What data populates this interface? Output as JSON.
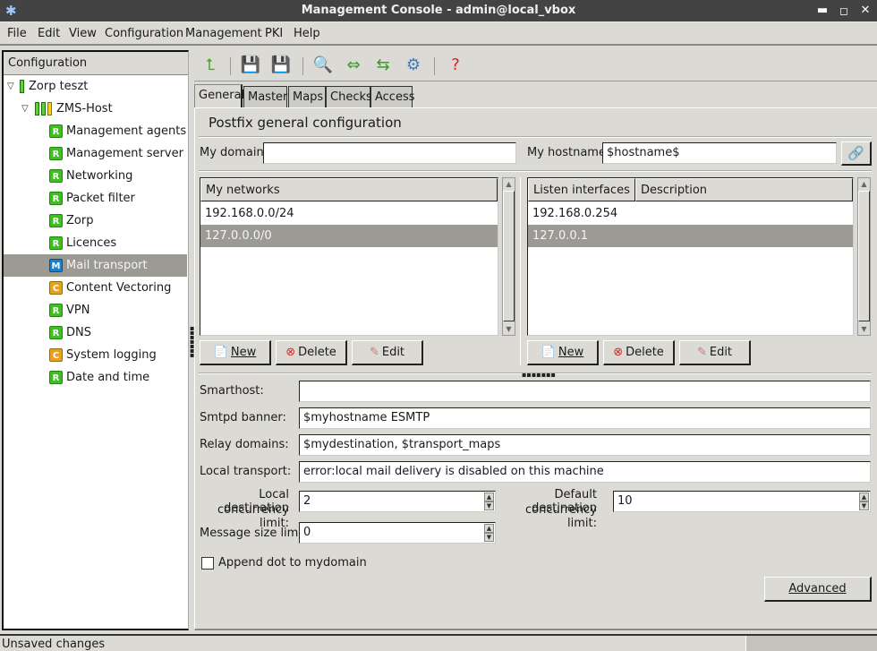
{
  "window": {
    "title": "Management Console - admin@local_vbox",
    "app_icon": "star-icon",
    "controls": [
      "minimize",
      "maximize",
      "close"
    ]
  },
  "menu": [
    "File",
    "Edit",
    "View",
    "Configuration",
    "Management",
    "PKI",
    "Help"
  ],
  "sidebar": {
    "header": "Configuration",
    "tree": [
      {
        "label": "Zorp teszt",
        "level": 0,
        "icon": "status-bar-green",
        "expanded": true
      },
      {
        "label": "ZMS-Host",
        "level": 1,
        "icon": "status-bars-green-green-yellow",
        "expanded": true
      },
      {
        "label": "Management agents",
        "level": 2,
        "badge": "R"
      },
      {
        "label": "Management server",
        "level": 2,
        "badge": "R"
      },
      {
        "label": "Networking",
        "level": 2,
        "badge": "R"
      },
      {
        "label": "Packet filter",
        "level": 2,
        "badge": "R"
      },
      {
        "label": "Zorp",
        "level": 2,
        "badge": "R"
      },
      {
        "label": "Licences",
        "level": 2,
        "badge": "R"
      },
      {
        "label": "Mail transport",
        "level": 2,
        "badge": "M",
        "selected": true
      },
      {
        "label": "Content Vectoring",
        "level": 2,
        "badge": "C"
      },
      {
        "label": "VPN",
        "level": 2,
        "badge": "R"
      },
      {
        "label": "DNS",
        "level": 2,
        "badge": "R"
      },
      {
        "label": "System logging",
        "level": 2,
        "badge": "C"
      },
      {
        "label": "Date and time",
        "level": 2,
        "badge": "R"
      }
    ]
  },
  "toolbar": [
    "go-up-icon",
    "commit-icon",
    "revert-icon",
    "search-icon",
    "upload-icon",
    "host-transfer-icon",
    "settings-gear-icon",
    "save-question-icon"
  ],
  "tabs": [
    "General",
    "Master",
    "Maps",
    "Checks",
    "Access"
  ],
  "active_tab": "General",
  "section_title": "Postfix general configuration",
  "form": {
    "my_domain": {
      "label": "My domain:",
      "value": ""
    },
    "my_hostname": {
      "label": "My hostname:",
      "value": "$hostname$"
    },
    "networks": {
      "header": "My networks",
      "rows": [
        "192.168.0.0/24",
        "127.0.0.0/0"
      ],
      "selected_index": 1
    },
    "interfaces": {
      "headers": [
        "Listen interfaces",
        "Description"
      ],
      "rows": [
        [
          "192.168.0.254",
          ""
        ],
        [
          "127.0.0.1",
          ""
        ]
      ],
      "selected_index": 1
    },
    "buttons": {
      "new": "New",
      "delete": "Delete",
      "edit": "Edit"
    },
    "smarthost": {
      "label": "Smarthost:",
      "value": ""
    },
    "smtpd_banner": {
      "label": "Smtpd banner:",
      "value": "$myhostname ESMTP"
    },
    "relay_domains": {
      "label": "Relay domains:",
      "value": "$mydestination, $transport_maps"
    },
    "local_transport": {
      "label": "Local transport:",
      "value": "error:local mail delivery is disabled on this machine"
    },
    "local_dest_limit": {
      "label1": "Local destination",
      "label2": "concurrency limit:",
      "value": "2"
    },
    "default_dest_limit": {
      "label1": "Default destination",
      "label2": "concurrency limit:",
      "value": "10"
    },
    "message_size_limit": {
      "label": "Message size limit:",
      "value": "0"
    },
    "append_dot": {
      "label": "Append dot to mydomain",
      "checked": false
    },
    "advanced": "Advanced"
  },
  "status": "Unsaved changes"
}
